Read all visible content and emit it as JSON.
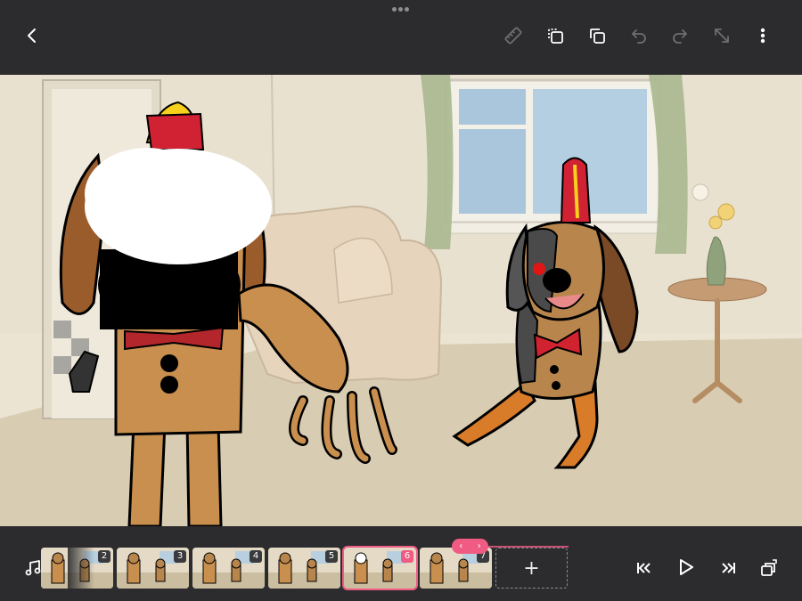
{
  "topbar": {
    "back_icon": "chevron-left-icon",
    "tools": [
      "ruler-icon",
      "duplicate-frame-icon",
      "copy-icon",
      "undo-icon",
      "redo-icon",
      "resize-icon",
      "more-icon"
    ]
  },
  "timeline": {
    "frames": [
      {
        "number": "2"
      },
      {
        "number": "3"
      },
      {
        "number": "4"
      },
      {
        "number": "5"
      },
      {
        "number": "6",
        "selected": true
      },
      {
        "number": "7"
      }
    ],
    "add_label": "+",
    "range_prev": "‹",
    "range_next": "›"
  },
  "colors": {
    "accent": "#ef5b83",
    "toolbar": "#2c2c2e"
  }
}
